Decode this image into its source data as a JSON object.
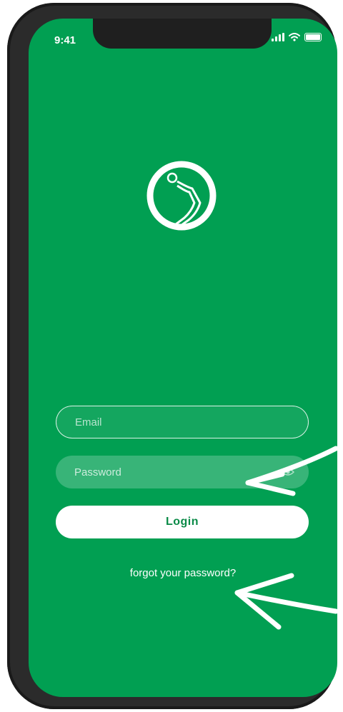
{
  "status_bar": {
    "time": "9:41"
  },
  "logo": {
    "icon": "brand-logo-icon"
  },
  "login_form": {
    "email_placeholder": "Email",
    "password_placeholder": "Password",
    "login_label": "Login",
    "forgot_password": "forgot your password?"
  },
  "colors": {
    "background": "#019f52",
    "button": "#ffffff",
    "button_text": "#0a8a47"
  }
}
